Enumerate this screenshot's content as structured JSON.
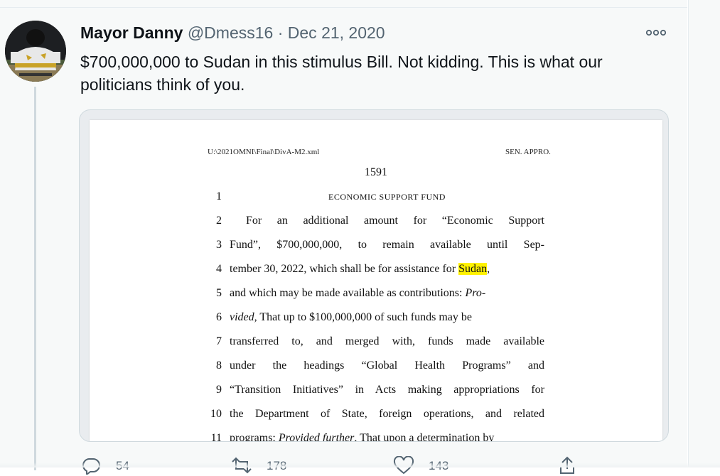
{
  "tweet": {
    "display_name": "Mayor Danny",
    "handle": "@Dmess16",
    "separator": "·",
    "date": "Dec 21, 2020",
    "text": "$700,000,000 to Sudan in this stimulus Bill. Not kidding. This is what our politicians think of you."
  },
  "document": {
    "path": "U:\\2021OMNI\\Final\\DivA-M2.xml",
    "committee": "SEN. APPRO.",
    "page_number": "1591",
    "lines": [
      {
        "num": "1",
        "text": "ECONOMIC SUPPORT FUND"
      },
      {
        "num": "2",
        "text": "For an additional amount for “Economic Support"
      },
      {
        "num": "3",
        "text": "Fund”, $700,000,000, to remain available until Sep-"
      },
      {
        "num": "4",
        "text_before": "tember 30, 2022, which shall be for assistance for ",
        "highlight": "Sudan",
        "text_after": ","
      },
      {
        "num": "5",
        "text_before": "and which may be made available as contributions: ",
        "italic": "Pro-"
      },
      {
        "num": "6",
        "italic": "vided",
        "text_after": ", That up to $100,000,000 of such funds may be"
      },
      {
        "num": "7",
        "text": "transferred to, and merged with, funds made available"
      },
      {
        "num": "8",
        "text": "under the headings “Global Health Programs” and"
      },
      {
        "num": "9",
        "text": "“Transition Initiatives” in Acts making appropriations for"
      },
      {
        "num": "10",
        "text": "the Department of State, foreign operations, and related"
      },
      {
        "num": "11",
        "text_before": "programs: ",
        "italic": "Provided further",
        "text_after": ", That upon a determination by"
      }
    ]
  },
  "actions": {
    "reply_count": "54",
    "retweet_count": "178",
    "like_count": "143"
  },
  "icons": {
    "more": "more-options-icon",
    "reply": "reply-icon",
    "retweet": "retweet-icon",
    "like": "like-icon",
    "share": "share-icon"
  },
  "colors": {
    "primary_text": "#0f1419",
    "secondary_text": "#536471",
    "highlight": "#fff200"
  }
}
